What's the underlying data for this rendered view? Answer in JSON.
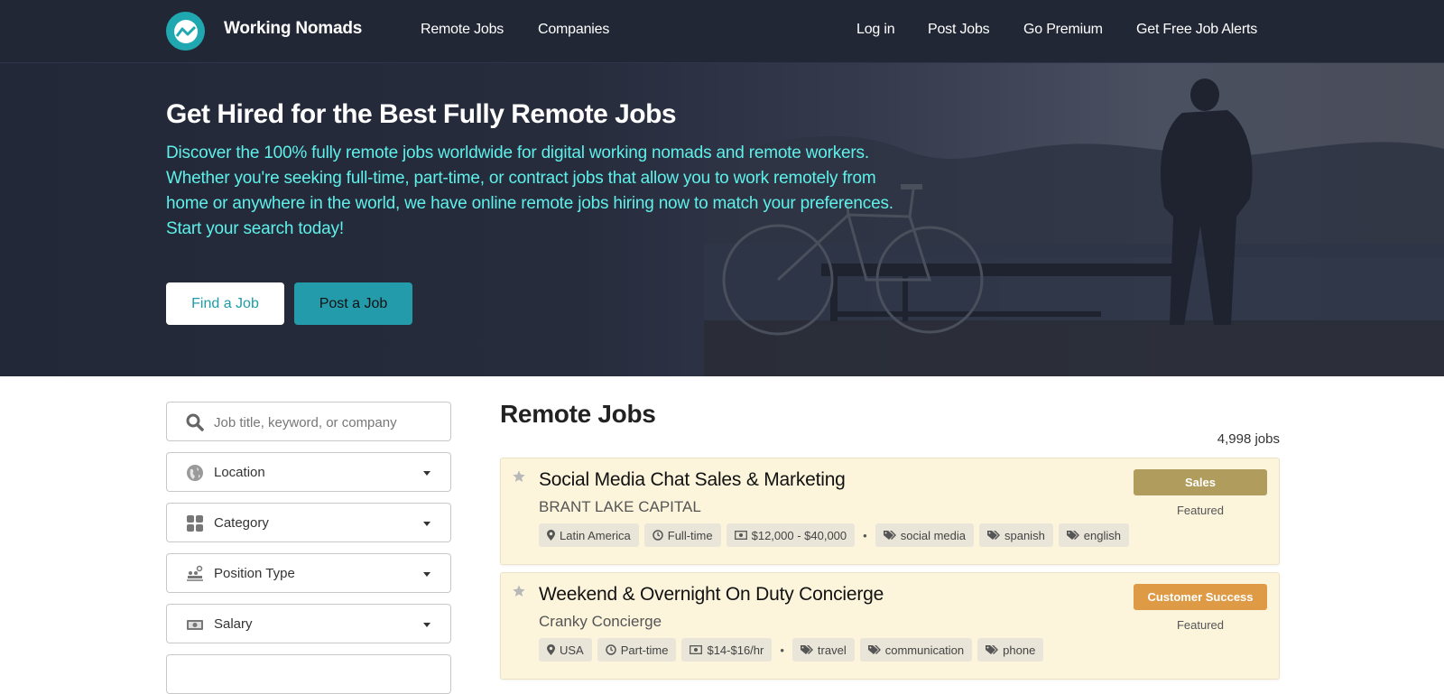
{
  "navbar": {
    "brand": "Working Nomads",
    "left_links": [
      "Remote Jobs",
      "Companies"
    ],
    "right_links": [
      "Log in",
      "Post Jobs",
      "Go Premium",
      "Get Free Job Alerts"
    ]
  },
  "hero": {
    "title": "Get Hired for the Best Fully Remote Jobs",
    "description": "Discover the 100% fully remote jobs worldwide for digital working nomads and remote workers. Whether you're seeking full-time, part-time, or contract jobs that allow you to work remotely from home or anywhere in the world, we have online remote jobs hiring now to match your preferences. Start your search today!",
    "find_button": "Find a Job",
    "post_button": "Post a Job"
  },
  "filters": {
    "search_placeholder": "Job title, keyword, or company",
    "search_value": "",
    "location": "Location",
    "category": "Category",
    "position_type": "Position Type",
    "salary": "Salary"
  },
  "main": {
    "title": "Remote Jobs",
    "job_count": "4,998 jobs",
    "jobs": [
      {
        "title": "Social Media Chat Sales & Marketing",
        "company": "BRANT LAKE CAPITAL",
        "location": "Latin America",
        "type": "Full-time",
        "salary": "$12,000 - $40,000",
        "tags": [
          "social media",
          "spanish",
          "english"
        ],
        "category": "Sales",
        "category_color": "#b09c5c",
        "featured": "Featured"
      },
      {
        "title": "Weekend & Overnight On Duty Concierge",
        "company": "Cranky Concierge",
        "location": "USA",
        "type": "Part-time",
        "salary": "$14-$16/hr",
        "tags": [
          "travel",
          "communication",
          "phone"
        ],
        "category": "Customer Success",
        "category_color": "#df9a45",
        "featured": "Featured"
      }
    ]
  },
  "colors": {
    "navbar_bg": "#222735",
    "brand_teal": "#1fa8b0",
    "hero_text": "#5ef0ea",
    "card_bg": "#fcf5dc"
  }
}
